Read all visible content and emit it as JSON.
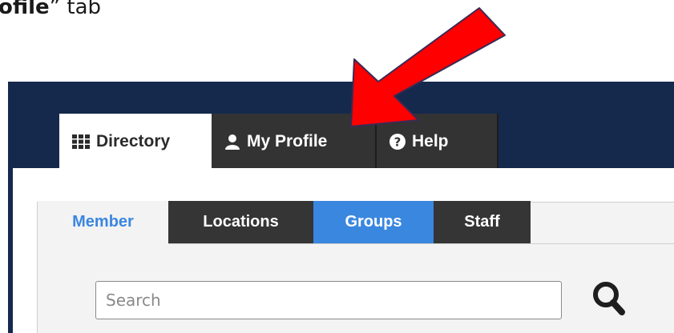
{
  "caption": {
    "bold": "ofile",
    "rest": "” tab"
  },
  "main_tabs": [
    {
      "label": "Directory",
      "icon": "grid-icon",
      "active": true
    },
    {
      "label": "My Profile",
      "icon": "user-icon",
      "active": false
    },
    {
      "label": "Help",
      "icon": "question-circle-icon",
      "active": false
    }
  ],
  "sub_tabs": [
    {
      "label": "Member",
      "active": true
    },
    {
      "label": "Locations",
      "active": false
    },
    {
      "label": "Groups",
      "highlighted": true
    },
    {
      "label": "Staff",
      "active": false
    }
  ],
  "search": {
    "placeholder": "Search",
    "icon": "search-icon"
  },
  "annotation": {
    "type": "arrow",
    "color": "#ff0000",
    "points_to": "My Profile tab"
  },
  "colors": {
    "navy": "#15294d",
    "accent": "#3a87e0",
    "tab_dark": "#333333",
    "panel": "#f3f3f3"
  }
}
